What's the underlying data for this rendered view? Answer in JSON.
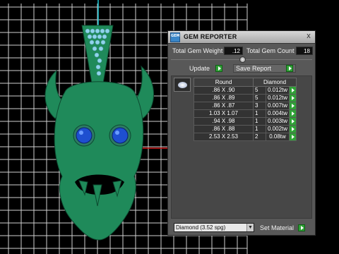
{
  "panel": {
    "title": "GEM REPORTER",
    "app_icon_text": "GEM",
    "close_label": "x",
    "total_weight_label": "Total Gem Weight",
    "total_weight_value": ".12",
    "total_count_label": "Total Gem Count",
    "total_count_value": "18",
    "update_label": "Update",
    "save_report_label": "Save Report",
    "headers": {
      "shape": "Round",
      "material": "Diamond"
    },
    "rows": [
      {
        "size": ".86 X .90",
        "qty": "5",
        "weight": "0.012tw"
      },
      {
        "size": ".86 X .89",
        "qty": "5",
        "weight": "0.012tw"
      },
      {
        "size": ".86 X .87",
        "qty": "3",
        "weight": "0.007tw"
      },
      {
        "size": "1.03 X 1.07",
        "qty": "1",
        "weight": "0.004tw"
      },
      {
        "size": ".94 X .98",
        "qty": "1",
        "weight": "0.003tw"
      },
      {
        "size": ".86 X .88",
        "qty": "1",
        "weight": "0.002tw"
      },
      {
        "size": "2.53 X 2.53",
        "qty": "2",
        "weight": "0.08tw"
      }
    ],
    "material_select_value": "Diamond    (3.52 spg)",
    "set_material_label": "Set Material"
  },
  "colors": {
    "panel_bg": "#585858",
    "accent_green": "#2fa136",
    "model_green": "#1f8a5a",
    "gem_blue": "#1e4fd0",
    "grid_line": "#e8e8e8",
    "axis_red": "#d01818",
    "axis_cyan": "#19c8d8"
  }
}
